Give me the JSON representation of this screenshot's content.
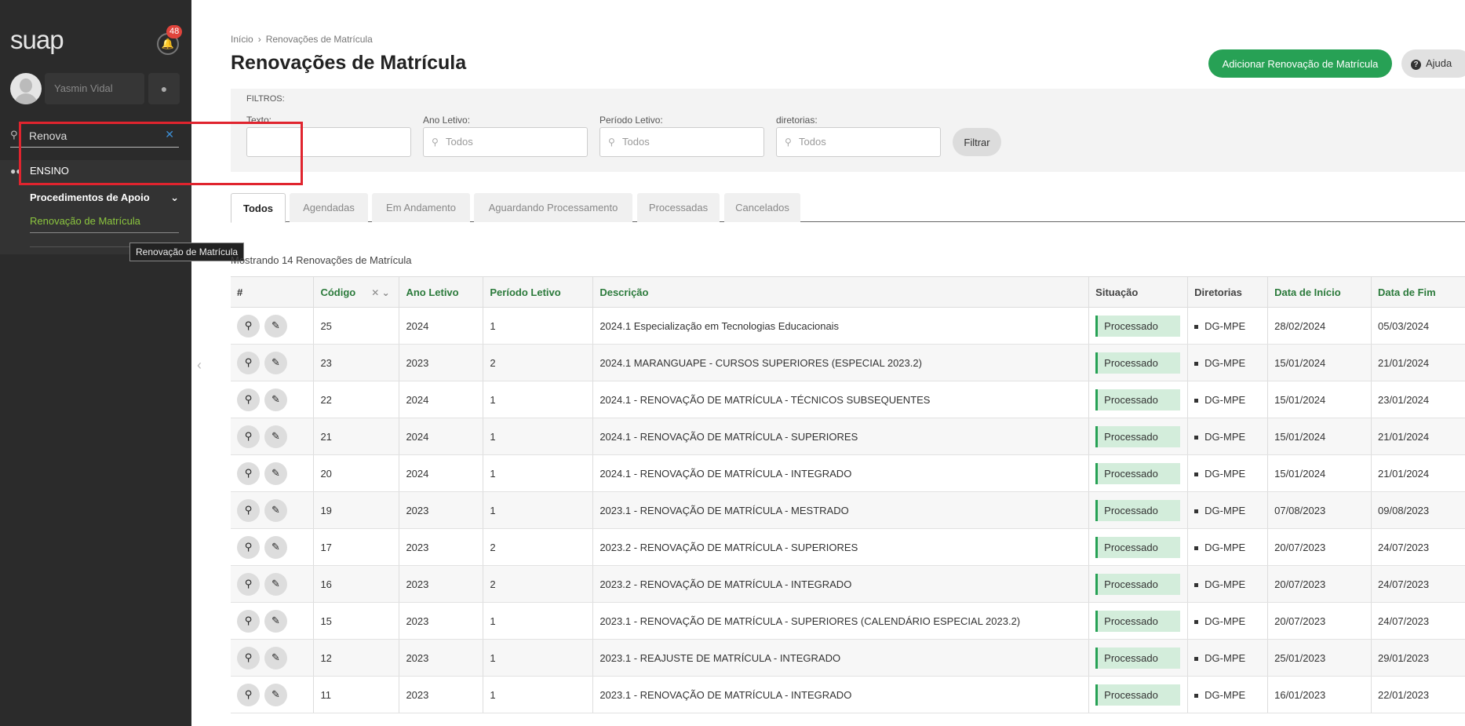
{
  "sidebar": {
    "logo": "suap",
    "notifications_count": "48",
    "user_name": "Yasmin Vidal",
    "search_value": "Renova",
    "section": "ENSINO",
    "submenu": "Procedimentos de Apoio",
    "leaf": "Renovação de Matrícula",
    "tooltip": "Renovação de Matrícula"
  },
  "breadcrumb": {
    "home": "Início",
    "current": "Renovações de Matrícula"
  },
  "header": {
    "title": "Renovações de Matrícula",
    "add_button": "Adicionar Renovação de Matrícula",
    "help_button": "Ajuda"
  },
  "filters": {
    "title": "FILTROS:",
    "texto_label": "Texto:",
    "ano_label": "Ano Letivo:",
    "ano_value": "Todos",
    "periodo_label": "Período Letivo:",
    "periodo_value": "Todos",
    "diretorias_label": "diretorias:",
    "diretorias_value": "Todos",
    "filter_button": "Filtrar"
  },
  "tabs": [
    "Todos",
    "Agendadas",
    "Em Andamento",
    "Aguardando Processamento",
    "Processadas",
    "Cancelados"
  ],
  "count_text": "Mostrando 14 Renovações de Matrícula",
  "table": {
    "headers": [
      "#",
      "Código",
      "Ano Letivo",
      "Período Letivo",
      "Descrição",
      "Situação",
      "Diretorias",
      "Data de Início",
      "Data de Fim"
    ],
    "rows": [
      [
        "25",
        "2024",
        "1",
        "2024.1 Especialização em Tecnologias Educacionais",
        "Processado",
        "DG-MPE",
        "28/02/2024",
        "05/03/2024"
      ],
      [
        "23",
        "2023",
        "2",
        "2024.1 MARANGUAPE - CURSOS SUPERIORES (ESPECIAL 2023.2)",
        "Processado",
        "DG-MPE",
        "15/01/2024",
        "21/01/2024"
      ],
      [
        "22",
        "2024",
        "1",
        "2024.1 - RENOVAÇÃO DE MATRÍCULA - TÉCNICOS SUBSEQUENTES",
        "Processado",
        "DG-MPE",
        "15/01/2024",
        "23/01/2024"
      ],
      [
        "21",
        "2024",
        "1",
        "2024.1 - RENOVAÇÃO DE MATRÍCULA - SUPERIORES",
        "Processado",
        "DG-MPE",
        "15/01/2024",
        "21/01/2024"
      ],
      [
        "20",
        "2024",
        "1",
        "2024.1 - RENOVAÇÃO DE MATRÍCULA - INTEGRADO",
        "Processado",
        "DG-MPE",
        "15/01/2024",
        "21/01/2024"
      ],
      [
        "19",
        "2023",
        "1",
        "2023.1 - RENOVAÇÃO DE MATRÍCULA - MESTRADO",
        "Processado",
        "DG-MPE",
        "07/08/2023",
        "09/08/2023"
      ],
      [
        "17",
        "2023",
        "2",
        "2023.2 - RENOVAÇÃO DE MATRÍCULA - SUPERIORES",
        "Processado",
        "DG-MPE",
        "20/07/2023",
        "24/07/2023"
      ],
      [
        "16",
        "2023",
        "2",
        "2023.2 - RENOVAÇÃO DE MATRÍCULA - INTEGRADO",
        "Processado",
        "DG-MPE",
        "20/07/2023",
        "24/07/2023"
      ],
      [
        "15",
        "2023",
        "1",
        "2023.1 - RENOVAÇÃO DE MATRÍCULA - SUPERIORES (CALENDÁRIO ESPECIAL 2023.2)",
        "Processado",
        "DG-MPE",
        "20/07/2023",
        "24/07/2023"
      ],
      [
        "12",
        "2023",
        "1",
        "2023.1 - REAJUSTE DE MATRÍCULA - INTEGRADO",
        "Processado",
        "DG-MPE",
        "25/01/2023",
        "29/01/2023"
      ],
      [
        "11",
        "2023",
        "1",
        "2023.1 - RENOVAÇÃO DE MATRÍCULA - INTEGRADO",
        "Processado",
        "DG-MPE",
        "16/01/2023",
        "22/01/2023"
      ]
    ]
  },
  "colors": {
    "accent_green": "#27a155",
    "sidebar_bg": "#2b2b2b",
    "badge_bg": "#d3eddb",
    "leaf_green": "#8cc63f"
  }
}
